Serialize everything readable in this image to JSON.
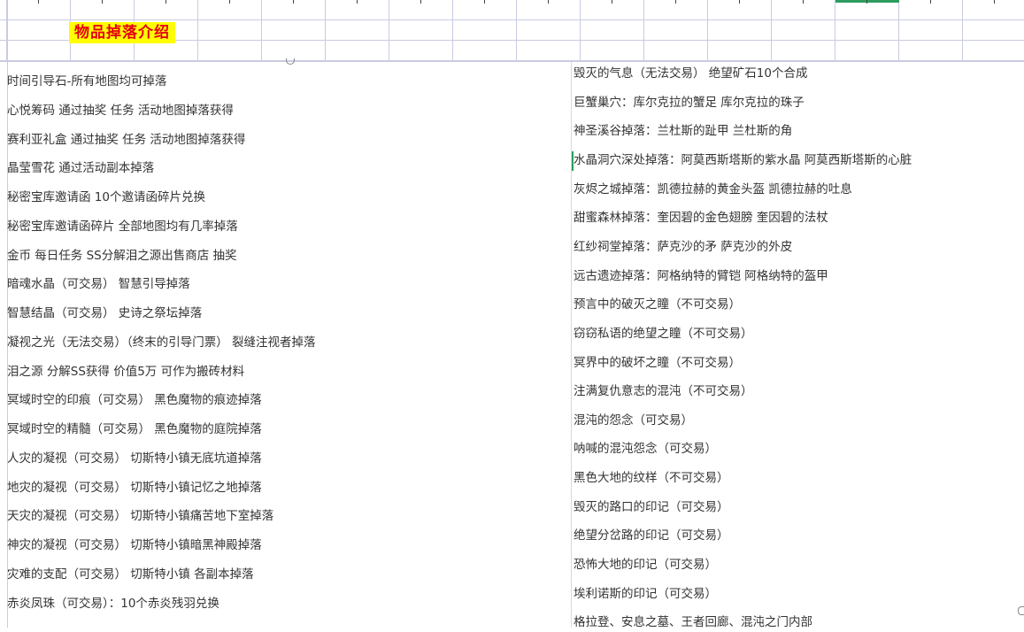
{
  "title": "物品掉落介绍",
  "colors": {
    "title_text": "#e60012",
    "title_bg": "#ffff00",
    "selection": "#2e9b5f"
  },
  "left_lines": [
    "时间引导石-所有地图均可掉落",
    "心悦筹码  通过抽奖 任务 活动地图掉落获得",
    "赛利亚礼盒  通过抽奖 任务 活动地图掉落获得",
    "晶莹雪花 通过活动副本掉落",
    "秘密宝库邀请函  10个邀请函碎片兑换",
    "秘密宝库邀请函碎片  全部地图均有几率掉落",
    "金币 每日任务 SS分解泪之源出售商店  抽奖",
    "暗魂水晶（可交易）  智慧引导掉落",
    "智慧结晶（可交易）  史诗之祭坛掉落",
    "凝视之光（无法交易）（终末的引导门票） 裂缝注视者掉落",
    "泪之源  分解SS获得  价值5万 可作为搬砖材料",
    "冥域时空的印痕（可交易）    黑色魔物的痕迹掉落",
    "冥域时空的精髓（可交易）   黑色魔物的庭院掉落",
    "人灾的凝视（可交易）  切斯特小镇无底坑道掉落",
    "地灾的凝视（可交易）  切斯特小镇记忆之地掉落",
    "天灾的凝视（可交易）  切斯特小镇痛苦地下室掉落",
    "神灾的凝视（可交易）  切斯特小镇暗黑神殿掉落",
    "灾难的支配（可交易）  切斯特小镇 各副本掉落",
    "赤炎凤珠（可交易）：10个赤炎残羽兑换"
  ],
  "right_lines": [
    "毁灭的气息（无法交易） 绝望矿石10个合成",
    "巨蟹巢穴：库尔克拉的蟹足 库尔克拉的珠子",
    "神圣溪谷掉落：兰杜斯的趾甲  兰杜斯的角",
    "水晶洞穴深处掉落：阿莫西斯塔斯的紫水晶 阿莫西斯塔斯的心脏",
    "灰烬之城掉落：凯德拉赫的黄金头盔   凯德拉赫的吐息",
    "甜蜜森林掉落：奎因碧的金色翅膀  奎因碧的法杖",
    "红纱祠堂掉落：萨克沙的矛  萨克沙的外皮",
    "远古遗迹掉落：阿格纳特的臂铠 阿格纳特的盔甲",
    "预言中的破灭之瞳（不可交易）",
    "窃窃私语的绝望之瞳（不可交易）",
    "冥界中的破坏之瞳（不可交易）",
    "注满复仇意志的混沌（不可交易）",
    "混沌的怨念（可交易）",
    "呐喊的混沌怨念（可交易）",
    "黑色大地的纹样（不可交易）",
    "毁灭的路口的印记（可交易）",
    "绝望分岔路的印记（可交易）",
    "恐怖大地的印记（可交易）",
    "埃利诺斯的印记（可交易）",
    "格拉登、安息之墓、王者回廊、混沌之门内部"
  ]
}
